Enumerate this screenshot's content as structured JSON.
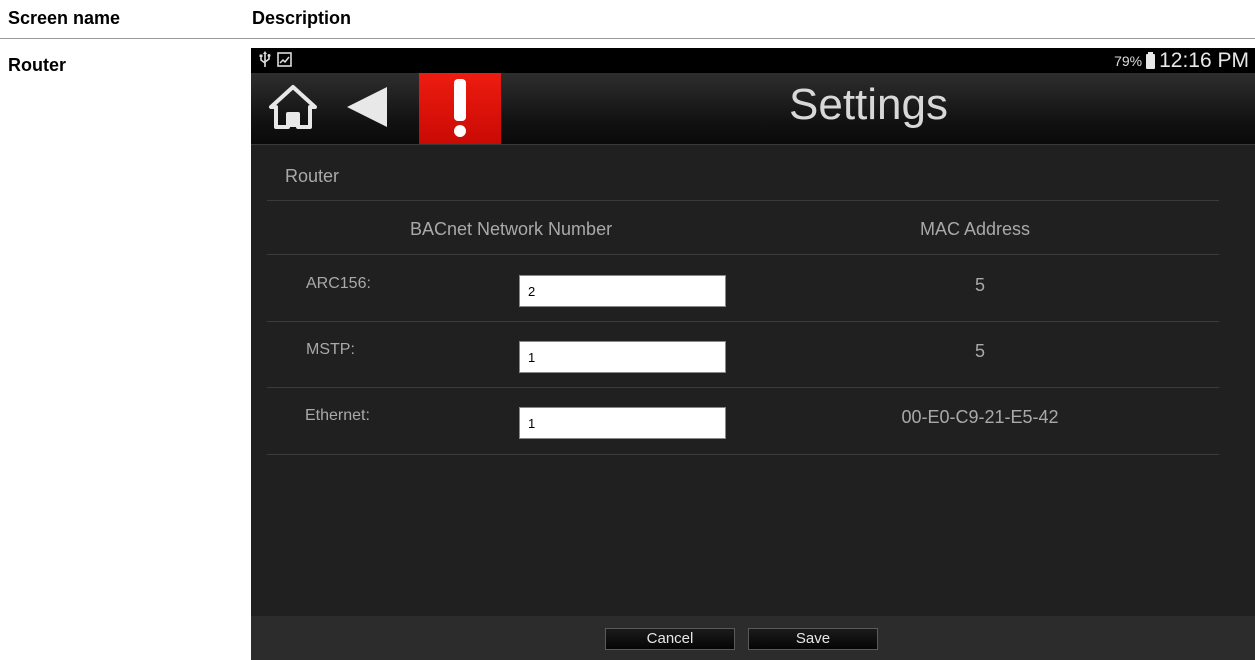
{
  "doc": {
    "header_screen_name": "Screen name",
    "header_description": "Description",
    "row_label": "Router"
  },
  "status_bar": {
    "left_icons": [
      "usb-icon",
      "image-icon"
    ],
    "battery_percent": "79%",
    "time": "12:16 PM"
  },
  "title_bar": {
    "home_icon": "home-icon",
    "back_icon": "back-arrow-icon",
    "alert_icon": "exclamation-icon",
    "title": "Settings",
    "alert_color": "#e0140a"
  },
  "panel": {
    "section_title": "Router",
    "col_network_number": "BACnet Network Number",
    "col_mac_address": "MAC Address",
    "rows": [
      {
        "name": "ARC156:",
        "network_number": "2",
        "mac": "5"
      },
      {
        "name": "MSTP:",
        "network_number": "1",
        "mac": "5"
      },
      {
        "name": "Ethernet:",
        "network_number": "1",
        "mac": "00-E0-C9-21-E5-42"
      }
    ]
  },
  "footer": {
    "cancel_label": "Cancel",
    "save_label": "Save"
  }
}
